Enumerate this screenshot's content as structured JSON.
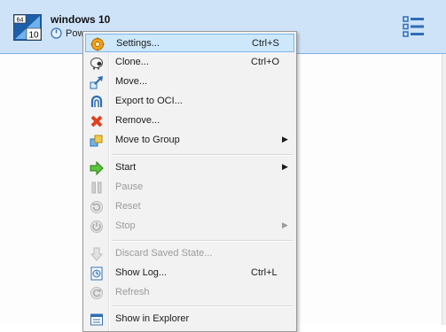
{
  "vm": {
    "name": "windows 10",
    "state": "Pow",
    "os_badge_top": "64",
    "os_badge_bottom": "10"
  },
  "menu": {
    "items": [
      {
        "label": "Settings...",
        "shortcut": "Ctrl+S"
      },
      {
        "label": "Clone...",
        "shortcut": "Ctrl+O"
      },
      {
        "label": "Move...",
        "shortcut": ""
      },
      {
        "label": "Export to OCI...",
        "shortcut": ""
      },
      {
        "label": "Remove...",
        "shortcut": ""
      },
      {
        "label": "Move to Group",
        "shortcut": "",
        "arrow": "▶"
      },
      {
        "label": "Start",
        "shortcut": "",
        "arrow": "▶"
      },
      {
        "label": "Pause",
        "shortcut": ""
      },
      {
        "label": "Reset",
        "shortcut": ""
      },
      {
        "label": "Stop",
        "shortcut": "",
        "arrow": "▶"
      },
      {
        "label": "Discard Saved State...",
        "shortcut": ""
      },
      {
        "label": "Show Log...",
        "shortcut": "Ctrl+L"
      },
      {
        "label": "Refresh",
        "shortcut": ""
      },
      {
        "label": "Show in Explorer",
        "shortcut": ""
      }
    ]
  },
  "colors": {
    "selection": "#cfe3f8",
    "menu_highlight": "#cde8fb",
    "disabled_text": "#9b9b9b"
  },
  "icons": {
    "settings": "gear-icon",
    "clone": "sheep-icon",
    "move": "move-icon",
    "export": "cloud-export-icon",
    "remove": "red-x-icon",
    "move_group": "group-icon",
    "start": "green-arrow-icon",
    "pause": "pause-icon",
    "reset": "reset-icon",
    "stop": "power-icon",
    "discard": "discard-icon",
    "log": "log-icon",
    "refresh": "refresh-icon",
    "explorer": "explorer-icon"
  }
}
